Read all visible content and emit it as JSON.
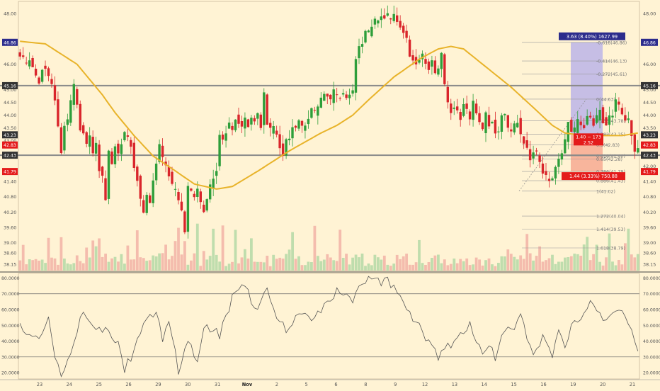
{
  "colors": {
    "background": "#fff3d4",
    "up": "#2e9e3a",
    "down": "#d9252b",
    "ma": "#e8b32a",
    "level_line": "#8a8a8a",
    "fib": "#9a9a9a",
    "rsi_line": "#555555",
    "price_tag_up": "#2c2c8c",
    "price_tag_red": "#e41b1b",
    "price_tag_dark": "#333333",
    "range_up_fill": "#b8b0e8",
    "range_down_fill": "#f6a58d"
  },
  "chart_data": [
    {
      "type": "candlestick",
      "ylim": [
        37.9,
        48.3
      ],
      "right_ticks": [
        "48.00",
        "46.00",
        "45.00",
        "44.50",
        "44.00",
        "43.50",
        "42.50",
        "42.00",
        "41.40",
        "40.80",
        "40.20",
        "39.60",
        "39.00",
        "38.60",
        "38.15"
      ],
      "left_ticks": [
        "48.00",
        "46.00",
        "45.00",
        "44.50",
        "44.00",
        "43.50",
        "43.00",
        "41.40",
        "40.80",
        "40.20",
        "39.60",
        "39.00",
        "38.60",
        "38.15"
      ],
      "x_labels": [
        "23",
        "24",
        "25",
        "26",
        "29",
        "30",
        "31",
        "Nov",
        "2",
        "5",
        "6",
        "8",
        "9",
        "12",
        "13",
        "14",
        "15",
        "16",
        "19",
        "20",
        "21"
      ],
      "price_tags": [
        {
          "value": "46.86",
          "y": 46.86,
          "kind": "up"
        },
        {
          "value": "45.16",
          "y": 45.16,
          "kind": "dark"
        },
        {
          "value": "43.23",
          "y": 43.23,
          "kind": "dark"
        },
        {
          "value": "42.83",
          "y": 42.83,
          "kind": "red"
        },
        {
          "value": "42.43",
          "y": 42.43,
          "kind": "dark"
        },
        {
          "value": "41.79",
          "y": 41.79,
          "kind": "red"
        }
      ],
      "horizontal_levels": [
        45.16,
        42.43
      ],
      "fib_levels": [
        {
          "label": "0(44.63)",
          "y": 44.63
        },
        {
          "label": "0.236(43.78)",
          "y": 43.78
        },
        {
          "label": "0.382(43.25)",
          "y": 43.25
        },
        {
          "label": "0.5(42.83)",
          "y": 42.83
        },
        {
          "label": "0.618(42.40)",
          "y": 42.4
        },
        {
          "label": "0.65(42.28)",
          "y": 42.28
        },
        {
          "label": "0.786(41.79)",
          "y": 41.79
        },
        {
          "label": "0.886(41.43)",
          "y": 41.43
        },
        {
          "label": "1(41.02)",
          "y": 41.02
        },
        {
          "label": "1.272(40.04)",
          "y": 40.04
        },
        {
          "label": "1.414(39.53)",
          "y": 39.53
        },
        {
          "label": "1.618(38.79)",
          "y": 38.79
        },
        {
          "label": "-0.272(45.61)",
          "y": 45.61
        },
        {
          "label": "-0.414(46.13)",
          "y": 46.13
        },
        {
          "label": "-0.618(46.86)",
          "y": 46.86
        }
      ],
      "range_boxes": {
        "up_label": "3.63 (8.40%) 1627.99",
        "down_label": "1.44 (3.33%) 750.88",
        "mid_label_1": "1.40 ~ 173",
        "mid_label_2": "2.52"
      },
      "path_knots": [
        [
          0,
          46.5
        ],
        [
          3,
          46.0
        ],
        [
          4,
          46.2
        ],
        [
          5,
          45.8
        ],
        [
          6,
          45.6
        ],
        [
          7,
          45.3
        ],
        [
          8,
          45.9
        ],
        [
          9,
          45.9
        ],
        [
          10,
          45.5
        ],
        [
          11,
          45.1
        ],
        [
          12,
          44.5
        ],
        [
          13,
          43.5
        ],
        [
          14,
          42.5
        ],
        [
          15,
          43.5
        ],
        [
          16,
          43.8
        ],
        [
          17,
          44.5
        ],
        [
          18,
          45.1
        ],
        [
          19,
          44.5
        ],
        [
          20,
          43.5
        ],
        [
          21,
          43.3
        ],
        [
          22,
          42.8
        ],
        [
          23,
          43.2
        ],
        [
          24,
          42.5
        ],
        [
          25,
          42.8
        ],
        [
          26,
          41.9
        ],
        [
          27,
          41.5
        ],
        [
          28,
          40.6
        ],
        [
          29,
          42.6
        ],
        [
          30,
          42.0
        ],
        [
          31,
          42.8
        ],
        [
          32,
          42.4
        ],
        [
          33,
          42.9
        ],
        [
          34,
          43.3
        ],
        [
          35,
          43.1
        ],
        [
          36,
          42.8
        ],
        [
          37,
          42.0
        ],
        [
          38,
          41.5
        ],
        [
          39,
          40.6
        ],
        [
          40,
          40.2
        ],
        [
          41,
          40.9
        ],
        [
          42,
          40.6
        ],
        [
          43,
          41.4
        ],
        [
          44,
          42.2
        ],
        [
          45,
          42.8
        ],
        [
          46,
          42.3
        ],
        [
          47,
          42.0
        ],
        [
          48,
          41.7
        ],
        [
          49,
          41.2
        ],
        [
          50,
          41.0
        ],
        [
          51,
          40.6
        ],
        [
          52,
          40.2
        ],
        [
          53,
          39.5
        ],
        [
          54,
          41.2
        ],
        [
          55,
          41.0
        ],
        [
          56,
          40.7
        ],
        [
          57,
          41.0
        ],
        [
          58,
          40.6
        ],
        [
          59,
          40.3
        ],
        [
          60,
          40.8
        ],
        [
          61,
          41.2
        ],
        [
          62,
          41.5
        ],
        [
          63,
          41.9
        ],
        [
          64,
          43.3
        ],
        [
          65,
          43.1
        ],
        [
          66,
          43.4
        ],
        [
          67,
          43.7
        ],
        [
          68,
          43.5
        ],
        [
          69,
          43.9
        ],
        [
          70,
          43.7
        ],
        [
          71,
          43.5
        ],
        [
          72,
          43.8
        ],
        [
          73,
          43.6
        ],
        [
          74,
          43.9
        ],
        [
          75,
          43.8
        ],
        [
          76,
          44.1
        ],
        [
          77,
          43.5
        ],
        [
          78,
          44.9
        ],
        [
          79,
          43.7
        ],
        [
          80,
          43.4
        ],
        [
          81,
          43.5
        ],
        [
          82,
          43.2
        ],
        [
          83,
          42.8
        ],
        [
          84,
          42.4
        ],
        [
          85,
          43.0
        ],
        [
          86,
          43.2
        ],
        [
          87,
          43.6
        ],
        [
          88,
          43.4
        ],
        [
          89,
          43.7
        ],
        [
          90,
          43.5
        ],
        [
          91,
          43.6
        ],
        [
          92,
          43.9
        ],
        [
          93,
          44.2
        ],
        [
          94,
          44.1
        ],
        [
          95,
          44.3
        ],
        [
          96,
          44.6
        ],
        [
          97,
          44.8
        ],
        [
          98,
          44.7
        ],
        [
          99,
          44.6
        ],
        [
          100,
          44.9
        ],
        [
          101,
          44.8
        ],
        [
          102,
          44.7
        ],
        [
          103,
          44.9
        ],
        [
          104,
          44.6
        ],
        [
          105,
          44.9
        ],
        [
          106,
          45.0
        ],
        [
          107,
          46.3
        ],
        [
          108,
          46.6
        ],
        [
          109,
          46.9
        ],
        [
          110,
          47.2
        ],
        [
          111,
          47.2
        ],
        [
          112,
          47.5
        ],
        [
          113,
          47.7
        ],
        [
          114,
          47.7
        ],
        [
          115,
          47.9
        ],
        [
          116,
          47.8
        ],
        [
          117,
          47.9
        ],
        [
          118,
          47.8
        ],
        [
          119,
          47.9
        ],
        [
          120,
          47.7
        ],
        [
          121,
          47.5
        ],
        [
          122,
          47.3
        ],
        [
          123,
          47.0
        ],
        [
          124,
          46.4
        ],
        [
          125,
          46.2
        ],
        [
          126,
          46.0
        ],
        [
          127,
          46.2
        ],
        [
          128,
          46.3
        ],
        [
          129,
          46.0
        ],
        [
          130,
          45.9
        ],
        [
          131,
          46.2
        ],
        [
          132,
          45.6
        ],
        [
          133,
          45.8
        ],
        [
          134,
          46.5
        ],
        [
          135,
          45.1
        ],
        [
          136,
          44.5
        ],
        [
          137,
          44.2
        ],
        [
          138,
          44.4
        ],
        [
          139,
          44.2
        ],
        [
          140,
          43.9
        ],
        [
          141,
          44.4
        ],
        [
          142,
          44.2
        ],
        [
          143,
          43.9
        ],
        [
          144,
          44.5
        ],
        [
          145,
          44.0
        ],
        [
          146,
          43.8
        ],
        [
          147,
          43.4
        ],
        [
          148,
          44.1
        ],
        [
          149,
          43.6
        ],
        [
          150,
          43.8
        ],
        [
          151,
          43.4
        ],
        [
          152,
          43.4
        ],
        [
          153,
          44.0
        ],
        [
          154,
          44.1
        ],
        [
          155,
          43.4
        ],
        [
          156,
          43.3
        ],
        [
          157,
          43.6
        ],
        [
          158,
          43.8
        ],
        [
          159,
          43.2
        ],
        [
          160,
          43.0
        ],
        [
          161,
          42.6
        ],
        [
          162,
          42.2
        ],
        [
          163,
          42.6
        ],
        [
          164,
          42.5
        ],
        [
          165,
          42.2
        ],
        [
          166,
          41.8
        ],
        [
          167,
          41.6
        ],
        [
          168,
          41.4
        ],
        [
          169,
          41.5
        ],
        [
          170,
          42.0
        ],
        [
          171,
          42.3
        ],
        [
          172,
          42.6
        ],
        [
          173,
          43.0
        ],
        [
          174,
          43.7
        ],
        [
          175,
          43.3
        ],
        [
          176,
          43.4
        ],
        [
          177,
          43.8
        ],
        [
          178,
          43.5
        ],
        [
          179,
          43.6
        ],
        [
          180,
          44.0
        ],
        [
          181,
          43.9
        ],
        [
          182,
          43.7
        ],
        [
          183,
          43.9
        ],
        [
          184,
          44.3
        ],
        [
          185,
          43.8
        ],
        [
          186,
          43.6
        ],
        [
          187,
          43.9
        ],
        [
          188,
          44.1
        ],
        [
          189,
          44.5
        ],
        [
          190,
          44.3
        ],
        [
          191,
          44.0
        ],
        [
          192,
          43.7
        ],
        [
          193,
          43.8
        ],
        [
          194,
          43.2
        ],
        [
          195,
          42.6
        ]
      ],
      "ma_knots": [
        [
          0,
          46.9
        ],
        [
          8,
          46.8
        ],
        [
          18,
          46.0
        ],
        [
          26,
          44.8
        ],
        [
          30,
          44.1
        ],
        [
          36,
          43.2
        ],
        [
          42,
          42.4
        ],
        [
          48,
          41.9
        ],
        [
          55,
          41.3
        ],
        [
          62,
          41.1
        ],
        [
          67,
          41.2
        ],
        [
          75,
          41.8
        ],
        [
          85,
          42.6
        ],
        [
          95,
          43.3
        ],
        [
          100,
          43.6
        ],
        [
          105,
          44.0
        ],
        [
          110,
          44.6
        ],
        [
          118,
          45.5
        ],
        [
          126,
          46.2
        ],
        [
          132,
          46.6
        ],
        [
          136,
          46.7
        ],
        [
          140,
          46.6
        ],
        [
          146,
          46.0
        ],
        [
          155,
          45.1
        ],
        [
          162,
          44.3
        ],
        [
          168,
          43.6
        ],
        [
          172,
          43.3
        ],
        [
          178,
          43.2
        ],
        [
          184,
          43.2
        ],
        [
          190,
          43.2
        ],
        [
          195,
          43.3
        ]
      ]
    },
    {
      "type": "line",
      "name_hint": "oscillator",
      "ylim": [
        16,
        82
      ],
      "ticks": [
        "80.0000",
        "70.0000",
        "60.0000",
        "50.0000",
        "40.0000",
        "30.0000",
        "20.0000"
      ],
      "levels": [
        70,
        30
      ],
      "knots": [
        [
          0,
          52
        ],
        [
          3,
          42
        ],
        [
          6,
          44
        ],
        [
          9,
          55
        ],
        [
          11,
          30
        ],
        [
          13,
          18
        ],
        [
          15,
          28
        ],
        [
          18,
          48
        ],
        [
          20,
          60
        ],
        [
          23,
          50
        ],
        [
          26,
          48
        ],
        [
          29,
          42
        ],
        [
          31,
          38
        ],
        [
          33,
          22
        ],
        [
          35,
          30
        ],
        [
          38,
          45
        ],
        [
          40,
          52
        ],
        [
          43,
          60
        ],
        [
          45,
          42
        ],
        [
          47,
          55
        ],
        [
          50,
          20
        ],
        [
          53,
          42
        ],
        [
          56,
          28
        ],
        [
          58,
          50
        ],
        [
          61,
          48
        ],
        [
          63,
          44
        ],
        [
          66,
          60
        ],
        [
          68,
          74
        ],
        [
          70,
          76
        ],
        [
          72,
          70
        ],
        [
          75,
          60
        ],
        [
          78,
          72
        ],
        [
          80,
          58
        ],
        [
          82,
          52
        ],
        [
          85,
          46
        ],
        [
          88,
          58
        ],
        [
          90,
          60
        ],
        [
          92,
          55
        ],
        [
          95,
          60
        ],
        [
          98,
          65
        ],
        [
          100,
          72
        ],
        [
          102,
          70
        ],
        [
          104,
          66
        ],
        [
          106,
          68
        ],
        [
          108,
          78
        ],
        [
          110,
          79
        ],
        [
          112,
          79
        ],
        [
          114,
          76
        ],
        [
          116,
          78
        ],
        [
          118,
          74
        ],
        [
          120,
          70
        ],
        [
          122,
          62
        ],
        [
          124,
          55
        ],
        [
          126,
          52
        ],
        [
          128,
          42
        ],
        [
          130,
          38
        ],
        [
          132,
          30
        ],
        [
          134,
          35
        ],
        [
          137,
          40
        ],
        [
          140,
          46
        ],
        [
          142,
          52
        ],
        [
          144,
          40
        ],
        [
          146,
          30
        ],
        [
          148,
          38
        ],
        [
          150,
          28
        ],
        [
          152,
          42
        ],
        [
          154,
          48
        ],
        [
          156,
          50
        ],
        [
          158,
          60
        ],
        [
          160,
          40
        ],
        [
          162,
          30
        ],
        [
          165,
          44
        ],
        [
          168,
          30
        ],
        [
          170,
          48
        ],
        [
          172,
          38
        ],
        [
          174,
          50
        ],
        [
          177,
          55
        ],
        [
          180,
          65
        ],
        [
          183,
          58
        ],
        [
          185,
          52
        ],
        [
          187,
          58
        ],
        [
          189,
          62
        ],
        [
          191,
          58
        ],
        [
          193,
          45
        ],
        [
          195,
          34
        ]
      ]
    }
  ]
}
